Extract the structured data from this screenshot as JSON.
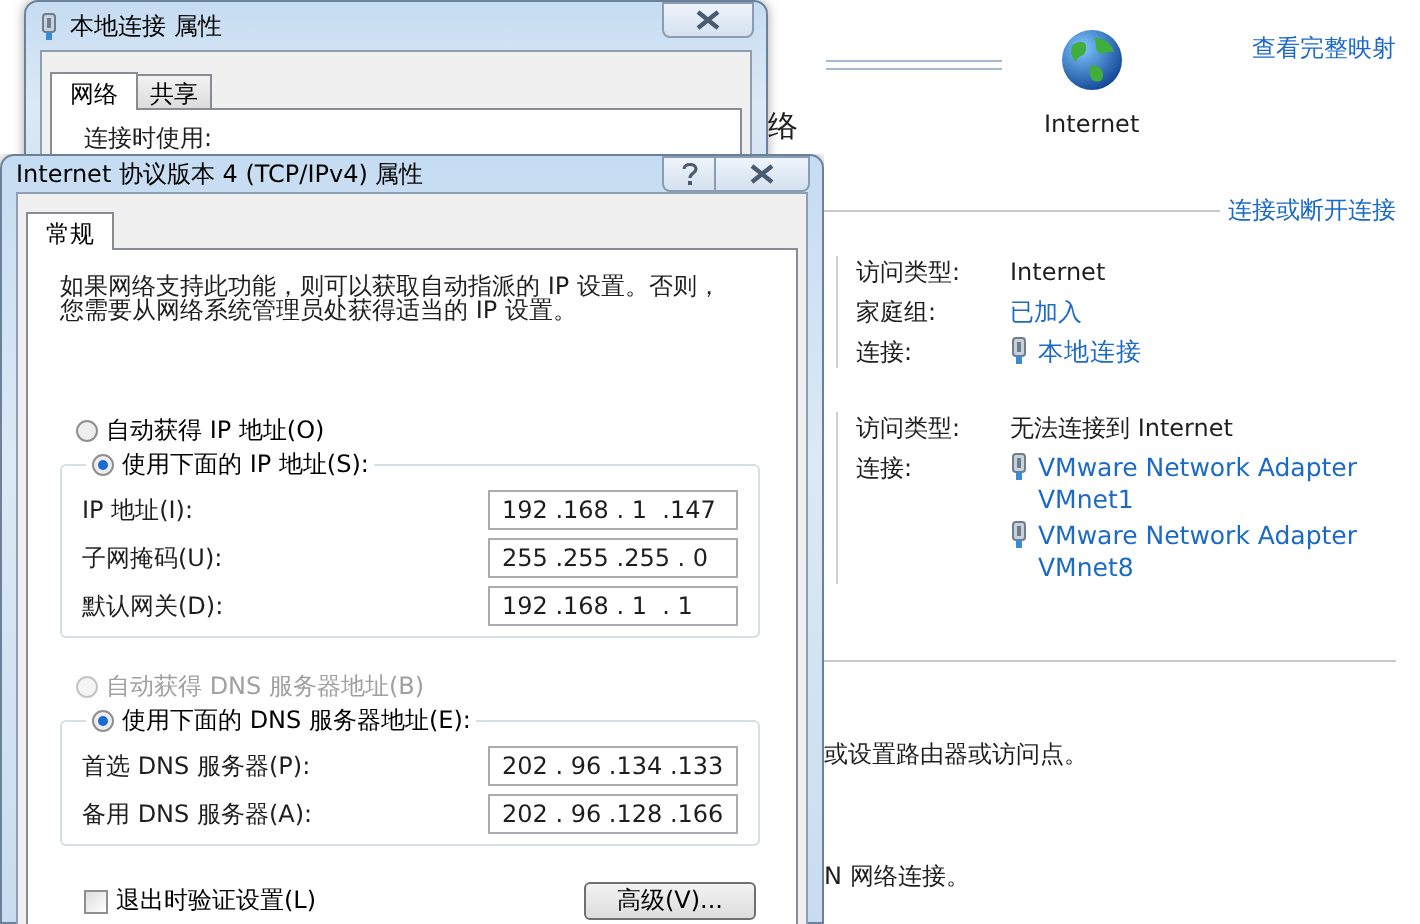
{
  "background": {
    "partial_heading": "络",
    "globe_label": "Internet",
    "map_link": "查看完整映射",
    "connect_link": "连接或断开连接",
    "networks": [
      {
        "rows": [
          {
            "kind": "text",
            "label": "访问类型:",
            "values": [
              "Internet"
            ]
          },
          {
            "kind": "link",
            "label": "家庭组:",
            "values": [
              "已加入"
            ]
          },
          {
            "kind": "adapters",
            "label": "连接:",
            "values": [
              "本地连接"
            ]
          }
        ]
      },
      {
        "rows": [
          {
            "kind": "text",
            "label": "访问类型:",
            "values": [
              "无法连接到 Internet"
            ]
          },
          {
            "kind": "adapters",
            "label": "连接:",
            "values": [
              "VMware Network Adapter VMnet1",
              "VMware Network Adapter VMnet8"
            ]
          }
        ]
      }
    ],
    "task_texts": [
      "或设置路由器或访问点。",
      "N 网络连接。"
    ]
  },
  "back_window": {
    "title": "本地连接 属性",
    "tabs": [
      {
        "label": "网络",
        "selected": true
      },
      {
        "label": "共享",
        "selected": false
      }
    ],
    "field_label": "连接时使用:"
  },
  "front_window": {
    "title": "Internet 协议版本 4 (TCP/IPv4) 属性",
    "tabs": [
      {
        "label": "常规",
        "selected": true
      }
    ],
    "description": "如果网络支持此功能，则可以获取自动指派的 IP 设置。否则，您需要从网络系统管理员处获得适当的 IP 设置。",
    "ip_options": [
      {
        "label": "自动获得 IP 地址(O)",
        "selected": false,
        "disabled": false
      },
      {
        "label": "使用下面的 IP 地址(S):",
        "selected": true,
        "disabled": false
      }
    ],
    "ip_fields": [
      {
        "label": "IP 地址(I):",
        "value": "192 .168 . 1  .147"
      },
      {
        "label": "子网掩码(U):",
        "value": "255 .255 .255 . 0"
      },
      {
        "label": "默认网关(D):",
        "value": "192 .168 . 1  . 1"
      }
    ],
    "dns_options": [
      {
        "label": "自动获得 DNS 服务器地址(B)",
        "selected": false,
        "disabled": true
      },
      {
        "label": "使用下面的 DNS 服务器地址(E):",
        "selected": true,
        "disabled": false
      }
    ],
    "dns_fields": [
      {
        "label": "首选 DNS 服务器(P):",
        "value": "202 . 96 .134 .133"
      },
      {
        "label": "备用 DNS 服务器(A):",
        "value": "202 . 96 .128 .166"
      }
    ],
    "validate": {
      "label": "退出时验证设置(L)",
      "checked": false
    },
    "advanced_button": "高级(V)..."
  }
}
